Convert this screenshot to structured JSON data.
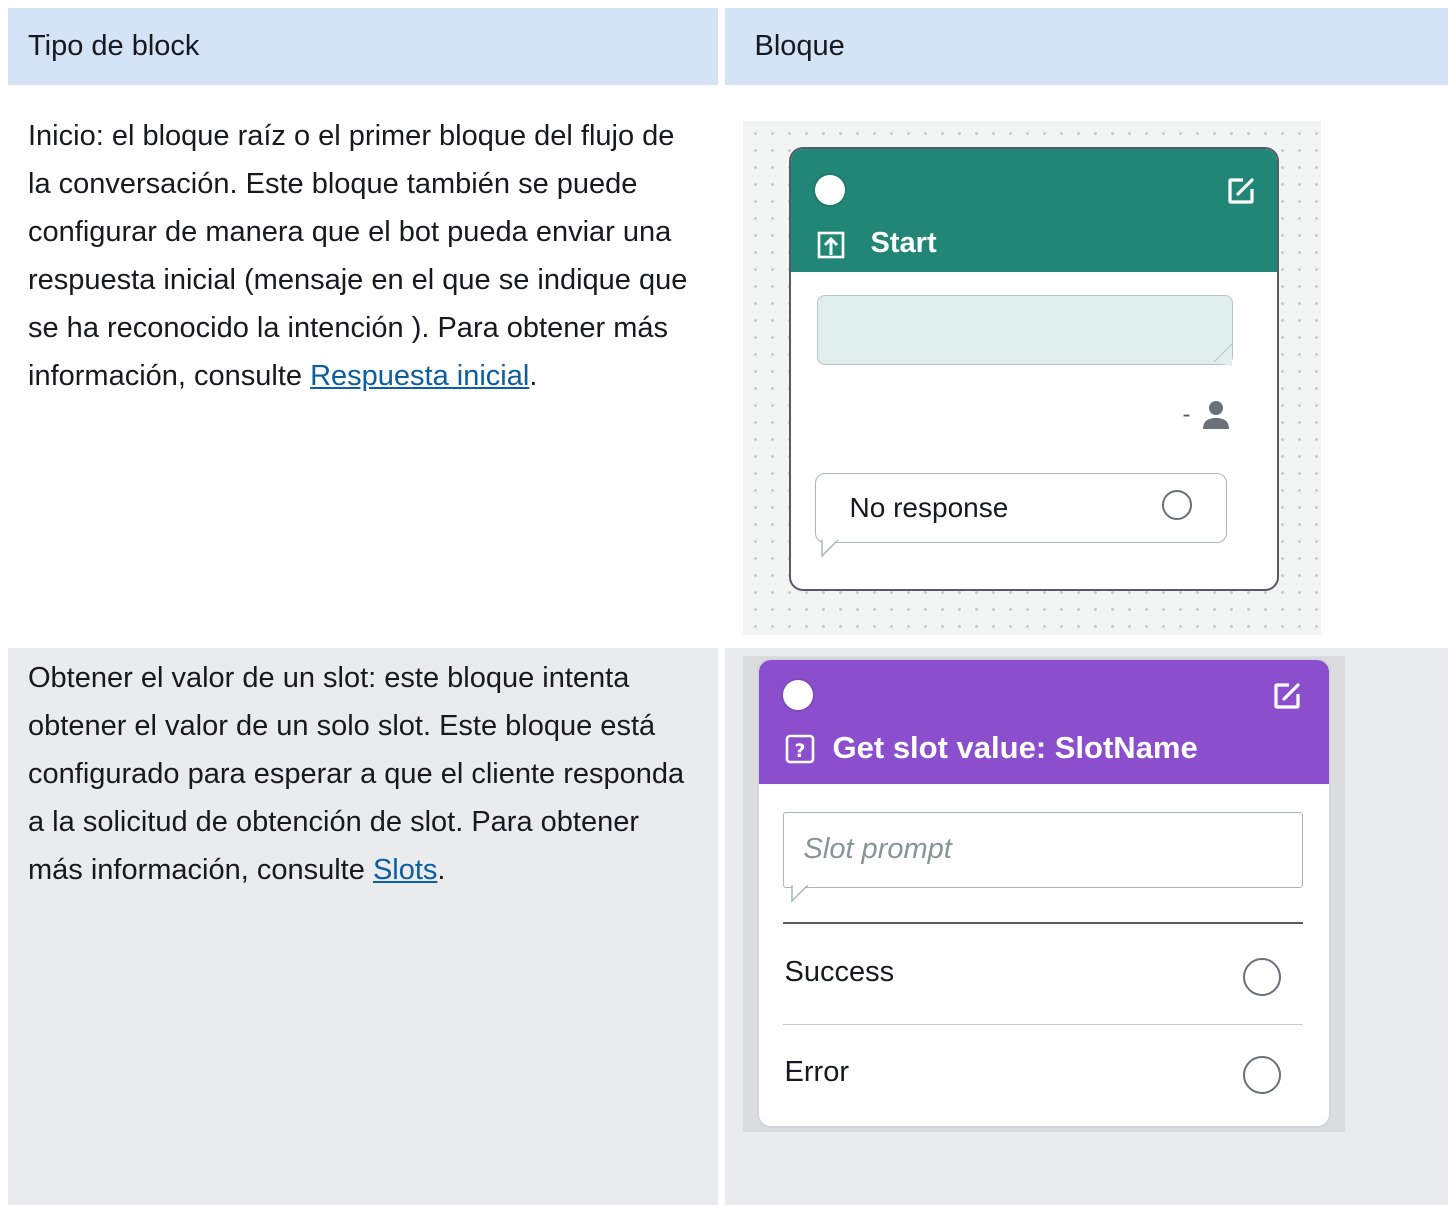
{
  "table": {
    "headers": [
      "Tipo de block",
      "Bloque"
    ],
    "rows": [
      {
        "description_before": "Inicio: el bloque raíz o el primer bloque del flujo de la conversación. Este bloque también se puede configurar de manera que el bot pueda enviar una respuesta inicial (mensaje en el que se indique que se ha reconocido la intención ). Para obtener más información, consulte ",
        "link_text": "Respuesta inicial",
        "description_after": "."
      },
      {
        "description_before": "Obtener el valor de un slot: este bloque intenta obtener el valor de un solo slot. Este bloque está configurado para esperar a que el cliente responda a la solicitud de obtención de slot. Para obtener más información, consulte ",
        "link_text": "Slots",
        "description_after": "."
      }
    ]
  },
  "start_block": {
    "title": "Start",
    "user_marker": "-",
    "no_response_label": "No response",
    "header_color": "#218676"
  },
  "slot_block": {
    "title": "Get slot value: SlotName",
    "prompt_placeholder": "Slot prompt",
    "outputs": [
      "Success",
      "Error"
    ],
    "header_color": "#8b4fcd"
  },
  "colors": {
    "header_bg": "#d4e3f5",
    "link": "#0b5ea0",
    "row2_bg": "#e9ebed"
  }
}
